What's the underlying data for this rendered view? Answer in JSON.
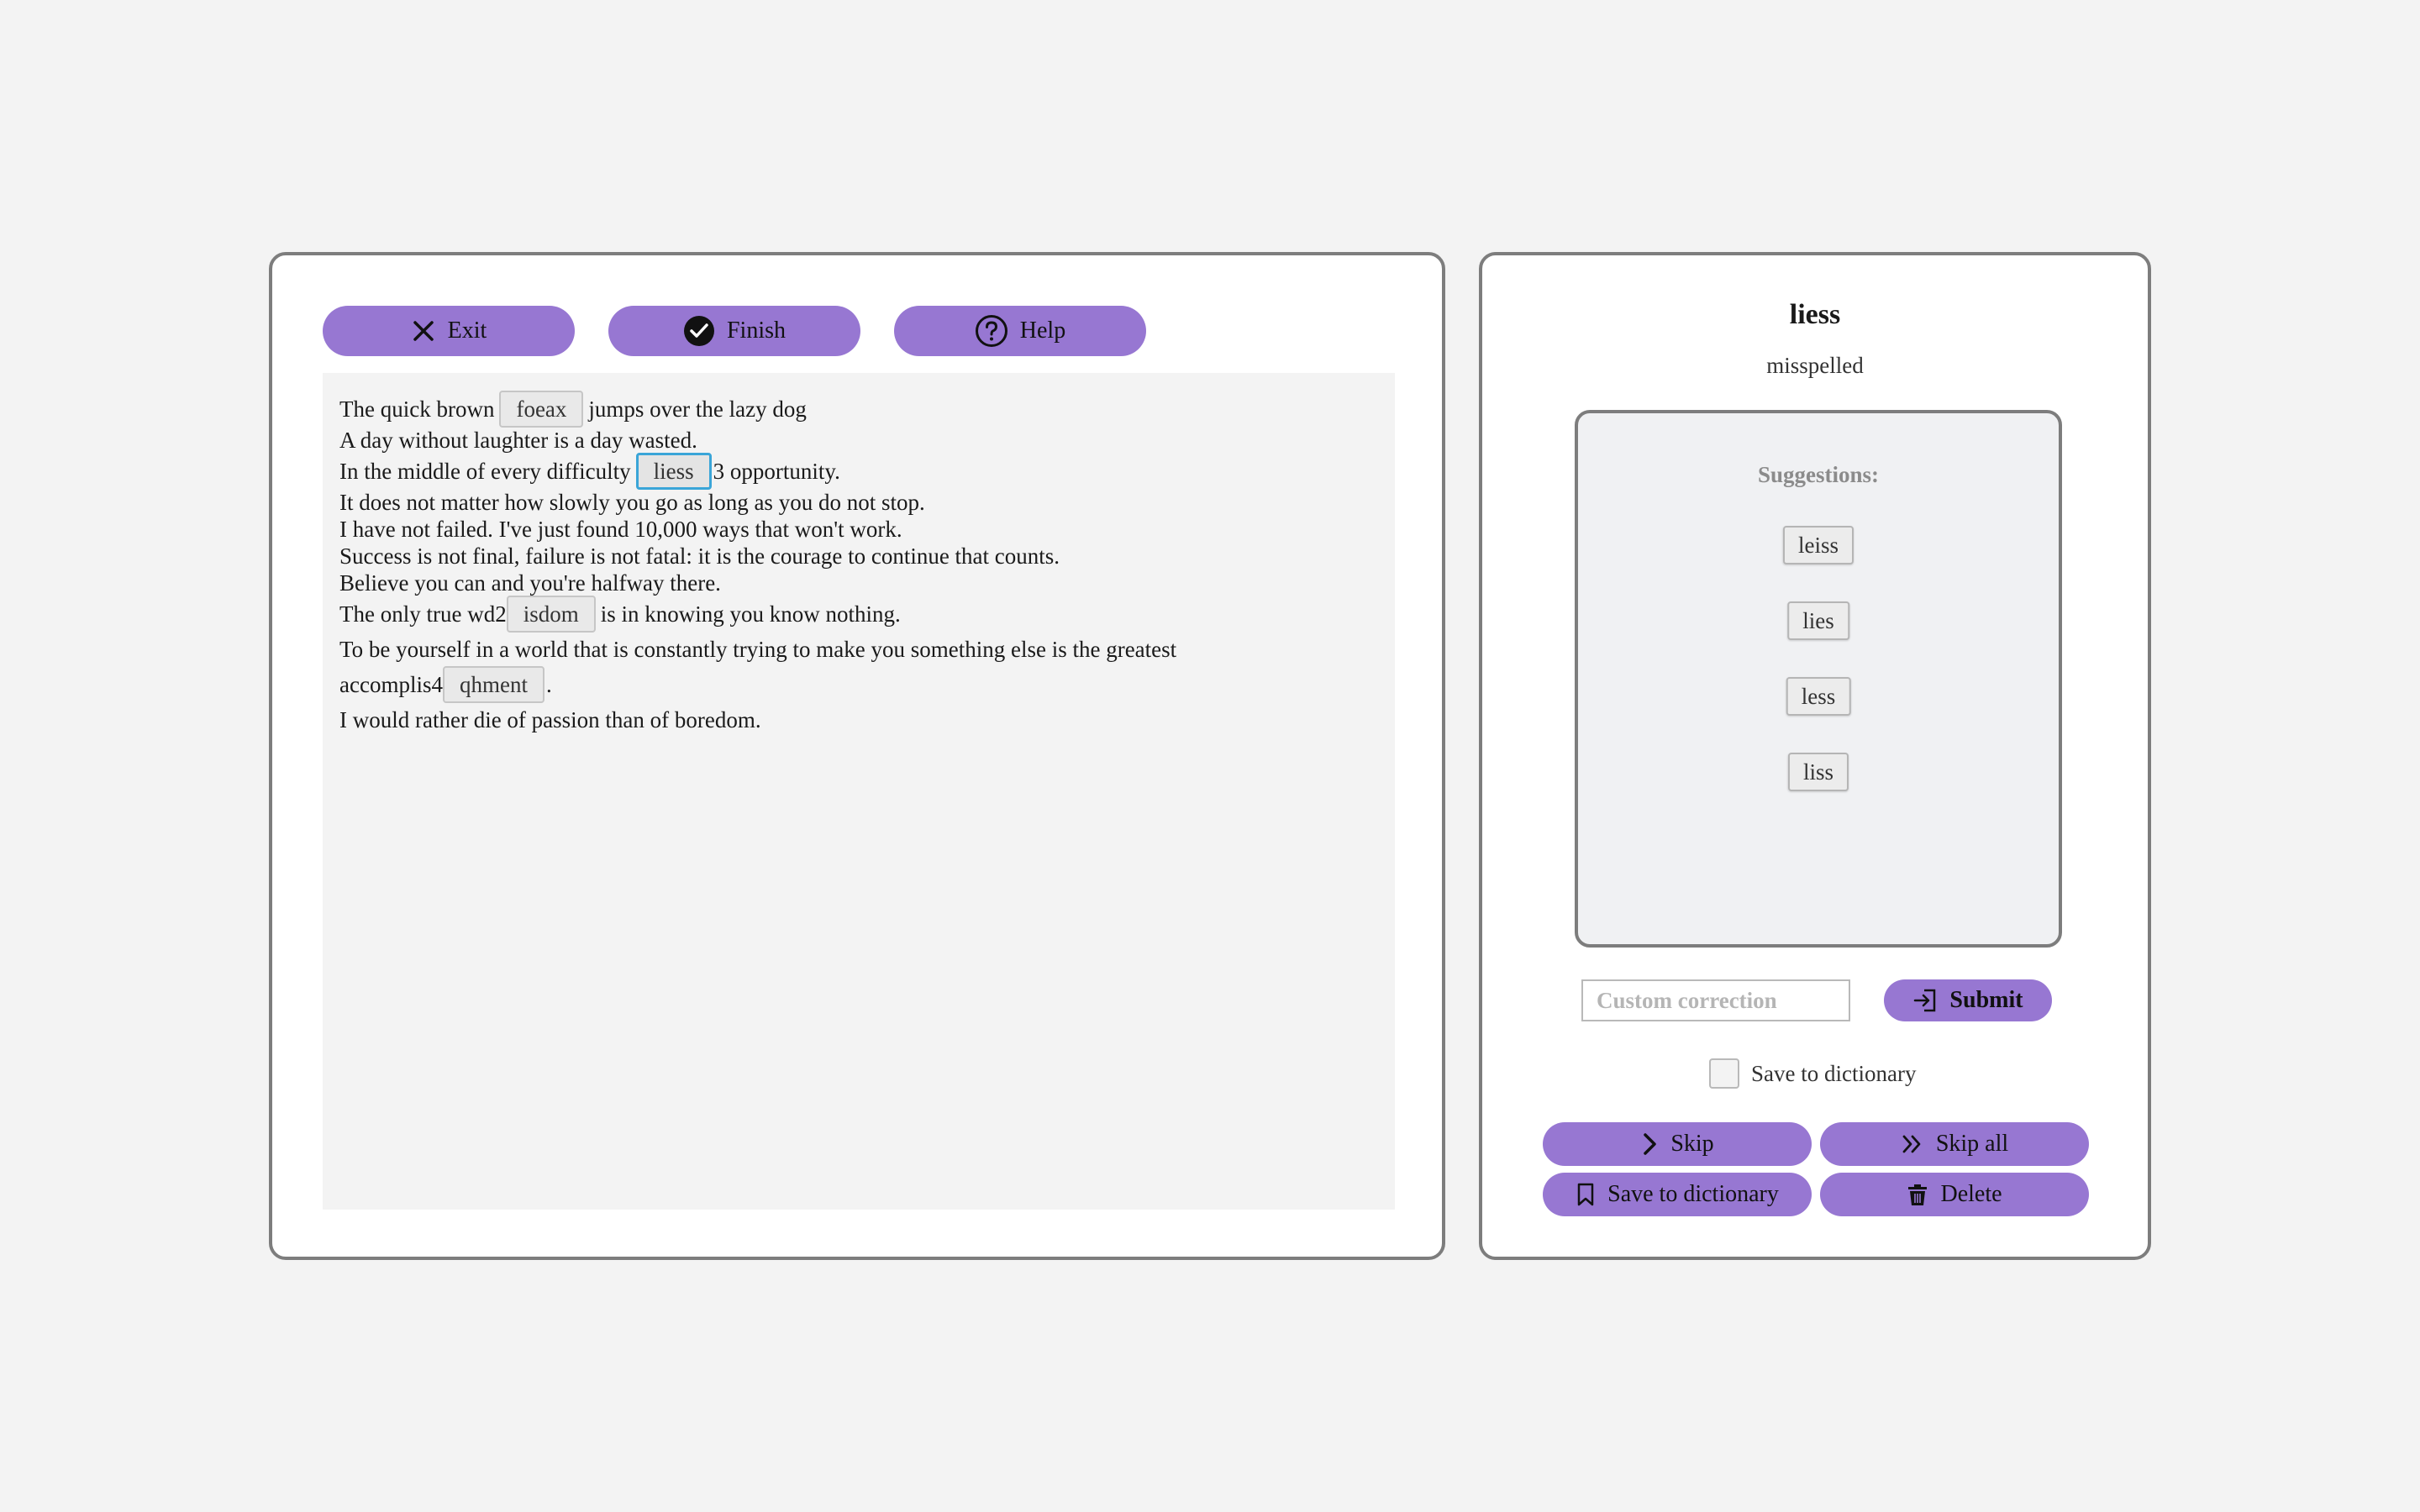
{
  "toolbar": {
    "exit_label": "Exit",
    "finish_label": "Finish",
    "help_label": "Help"
  },
  "document": {
    "line1": {
      "before": "The quick brown",
      "misspelled": "foeax",
      "after": "jumps over the lazy dog"
    },
    "line2": "A day without laughter is a day wasted.",
    "line3": {
      "before": "In the middle of every difficulty",
      "misspelled": "liess",
      "after": "3 opportunity."
    },
    "line4": "It does not matter how slowly you go as long as you do not stop.",
    "line5": "I have not failed. I've just found 10,000 ways that won't work.",
    "line6": "Success is not final, failure is not fatal: it is the courage to continue that counts.",
    "line7": "Believe you can and you're halfway there.",
    "line8": {
      "before": "The only true wd2",
      "misspelled": "isdom",
      "after": "is in knowing you know nothing."
    },
    "line9": "To be yourself in a world that is constantly trying to make you something else is the greatest",
    "line10": {
      "before": "accomplis4",
      "misspelled": "qhment",
      "after": "."
    },
    "line11": "I would rather die of passion than of boredom."
  },
  "sidebar": {
    "word": "liess",
    "status": "misspelled",
    "suggestions_heading": "Suggestions:",
    "suggestions": [
      "leiss",
      "lies",
      "less",
      "liss"
    ],
    "custom_placeholder": "Custom correction",
    "submit_label": "Submit",
    "save_checkbox_label": "Save to dictionary",
    "skip_label": "Skip",
    "skip_all_label": "Skip all",
    "save_dict_label": "Save to dictionary",
    "delete_label": "Delete"
  },
  "colors": {
    "accent": "#9777d2",
    "background": "#f3f3f3",
    "panel_border": "#7d7d7d",
    "active_chip_border": "#3aa5d8"
  },
  "icons": {
    "exit": "close-icon",
    "finish": "check-circle-icon",
    "help": "question-circle-icon",
    "submit": "enter-icon",
    "skip": "chevron-right-icon",
    "skip_all": "double-chevron-right-icon",
    "save_dict": "bookmark-icon",
    "delete": "trash-icon"
  }
}
